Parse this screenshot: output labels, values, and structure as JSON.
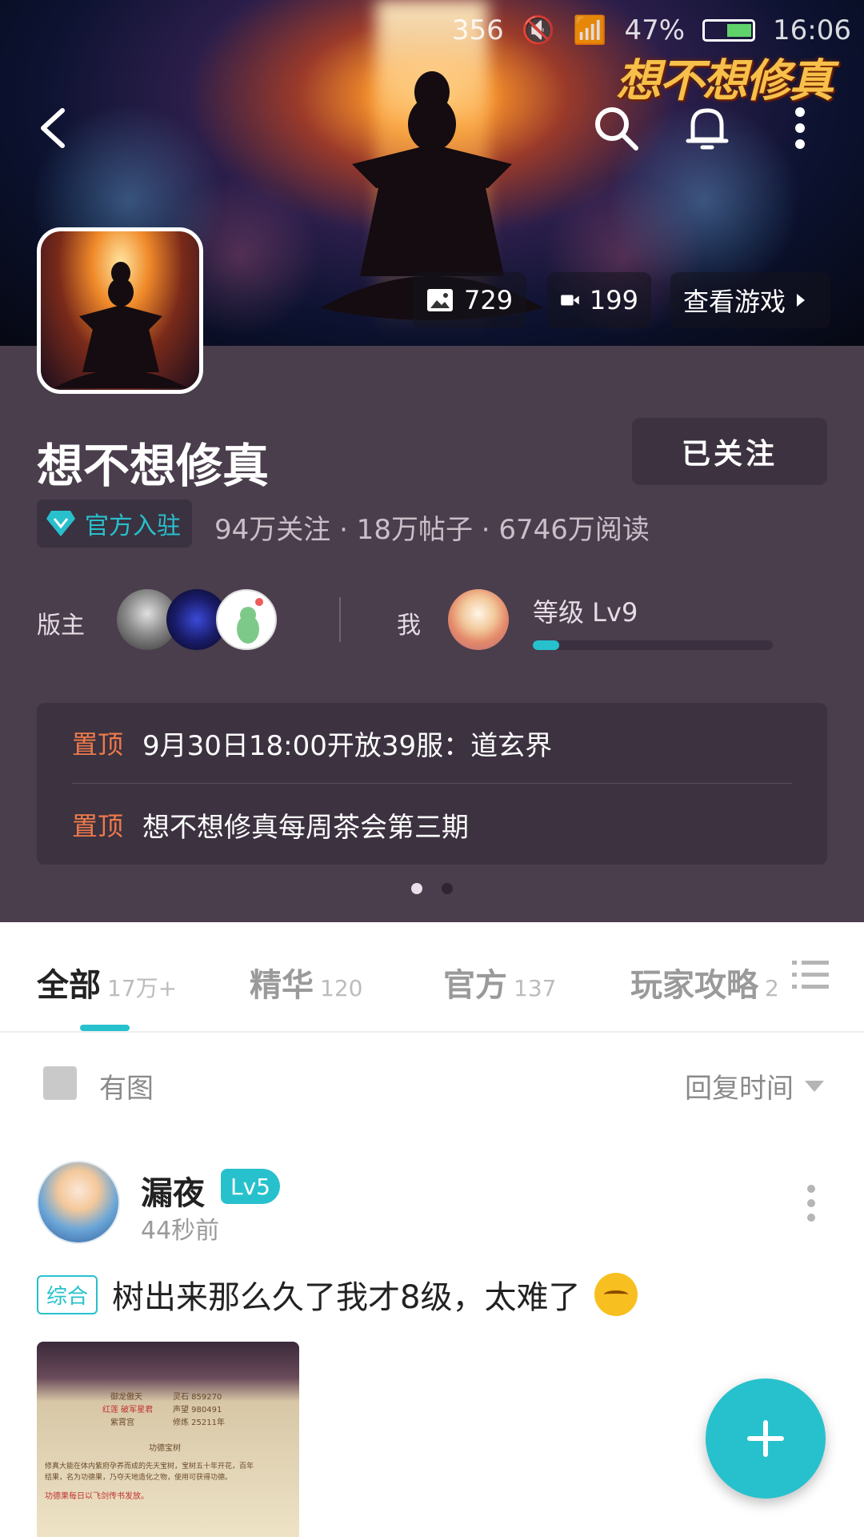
{
  "status_bar": {
    "network": "356",
    "battery_pct": "47%",
    "time": "16:06"
  },
  "banner": {
    "game_logo": "想不想修真"
  },
  "media_counts": {
    "images": "729",
    "videos": "199",
    "view_game": "查看游戏"
  },
  "forum": {
    "title": "想不想修真",
    "follow_button": "已关注",
    "official_badge": "官方入驻",
    "stats": "94万关注 · 18万帖子 · 6746万阅读"
  },
  "moderators": {
    "label": "版主"
  },
  "me": {
    "label": "我",
    "level": "等级 Lv9",
    "level_progress": 0.11
  },
  "pinned": [
    {
      "tag": "置顶",
      "text": "9月30日18:00开放39服：道玄界"
    },
    {
      "tag": "置顶",
      "text": "想不想修真每周茶会第三期"
    }
  ],
  "tabs": [
    {
      "label": "全部",
      "count": "17万+"
    },
    {
      "label": "精华",
      "count": "120"
    },
    {
      "label": "官方",
      "count": "137"
    },
    {
      "label": "玩家攻略",
      "count": "2"
    }
  ],
  "filter": {
    "image_toggle_label": "有图",
    "sort_label": "回复时间"
  },
  "post": {
    "username": "漏夜",
    "level": "Lv5",
    "time": "44秒前",
    "category": "综合",
    "title": "树出来那么久了我才8级，太难了",
    "thumb_lines": [
      "御龙傲天",
      "红莲 破军星君",
      "紫霄宫",
      "灵石 859270",
      "声望 980491",
      "修炼 25211年",
      "功德宝树",
      "修真大能在体内紫府孕养而成的先天宝树，宝树五十年开花，百年",
      "结果，名为功德果，乃夺天地造化之物，使用可获得功德。",
      "功德果每日以飞剑传书发放。"
    ]
  },
  "colors": {
    "accent": "#27c1cd",
    "header_bg": "#4a3d4c",
    "pinned_tag": "#ef7a4a"
  }
}
